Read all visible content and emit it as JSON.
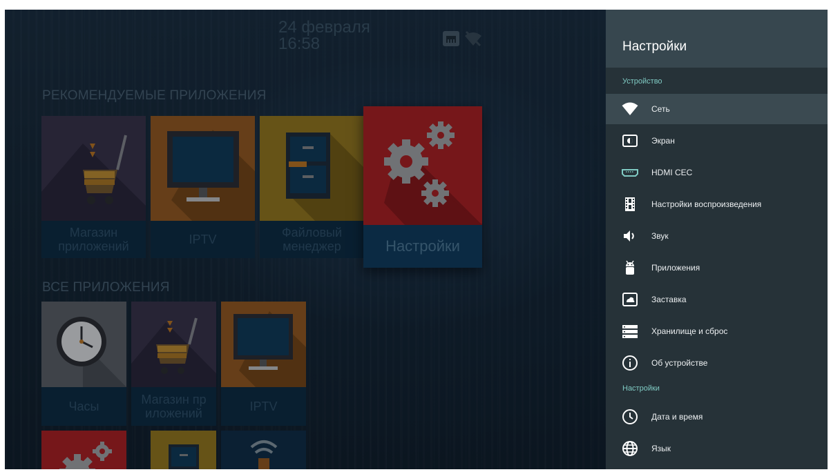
{
  "status": {
    "date": "24 февраля",
    "time": "16:58"
  },
  "launcher": {
    "recommended_title": "РЕКОМЕНДУЕМЫЕ ПРИЛОЖЕНИЯ",
    "recommended": [
      {
        "label": "Магазин приложений",
        "icon": "store-cart-icon",
        "color": "#3a3248"
      },
      {
        "label": "IPTV",
        "icon": "monitor-icon",
        "color": "#9a5a1c"
      },
      {
        "label": "Файловый менеджер",
        "icon": "file-cabinet-icon",
        "color": "#9a7a1a"
      },
      {
        "label": "Настройки",
        "icon": "gears-icon",
        "color": "#b21e1e"
      }
    ],
    "all_title": "ВСЕ ПРИЛОЖЕНИЯ",
    "all": [
      {
        "label": "Часы",
        "icon": "clock-icon",
        "color": "#5e6266"
      },
      {
        "label": "Магазин пр иложений",
        "icon": "store-cart-icon",
        "color": "#3a3248"
      },
      {
        "label": "IPTV",
        "icon": "monitor-icon",
        "color": "#9a5a1c"
      }
    ]
  },
  "settings_panel": {
    "title": "Настройки",
    "category_device": "Устройство",
    "category_settings": "Настройки",
    "device_items": [
      {
        "label": "Сеть",
        "icon": "wifi-icon",
        "selected": true
      },
      {
        "label": "Экран",
        "icon": "screen-icon"
      },
      {
        "label": "HDMI CEC",
        "icon": "hdmi-icon"
      },
      {
        "label": "Настройки воспроизведения",
        "icon": "film-icon"
      },
      {
        "label": "Звук",
        "icon": "volume-icon"
      },
      {
        "label": "Приложения",
        "icon": "android-icon"
      },
      {
        "label": "Заставка",
        "icon": "screensaver-icon"
      },
      {
        "label": "Хранилище и сброс",
        "icon": "storage-icon"
      },
      {
        "label": "Об устройстве",
        "icon": "info-icon"
      }
    ],
    "settings_items": [
      {
        "label": "Дата и время",
        "icon": "clock-icon"
      },
      {
        "label": "Язык",
        "icon": "globe-icon"
      }
    ]
  },
  "colors": {
    "accent_teal": "#80cbc4",
    "panel_bg": "#263238",
    "panel_header_bg": "#37474f",
    "selected_row_bg": "#3b4a51"
  }
}
